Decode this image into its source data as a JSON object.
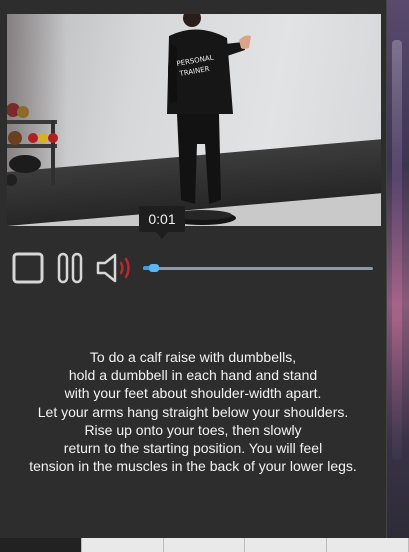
{
  "video": {
    "current_time": "0:01",
    "progress": 0.07,
    "progress_percent": 7,
    "shirt_text": "PERSONAL TRAINER"
  },
  "controls": {
    "stop_icon": "stop-icon",
    "pause_icon": "pause-icon",
    "volume_icon": "volume-icon"
  },
  "description": {
    "lines": [
      "To do a calf raise with dumbbells,",
      "hold a dumbbell in each hand and stand",
      "with your feet about shoulder-width apart.",
      "Let your arms hang straight below your shoulders.",
      "Rise up onto your toes, then slowly",
      "return to the starting position. You will feel",
      "tension in the muscles in the back of your lower legs."
    ]
  },
  "colors": {
    "modal_bg": "#2d2d2d",
    "progress_accent": "#3aa0e6",
    "icon": "#d6d6d6",
    "volume_wave": "#c0262b"
  }
}
